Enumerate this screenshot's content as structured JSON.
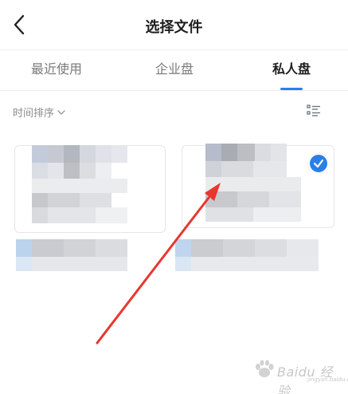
{
  "header": {
    "title": "选择文件",
    "back_icon": "chevron-left-icon"
  },
  "tabs": [
    {
      "label": "最近使用",
      "active": false
    },
    {
      "label": "企业盘",
      "active": false
    },
    {
      "label": "私人盘",
      "active": true
    }
  ],
  "sortbar": {
    "sort_label": "时间排序",
    "sort_icon": "chevron-down-icon",
    "view_icon": "list-view-icon"
  },
  "files": [
    {
      "selected": false,
      "blurred": true
    },
    {
      "selected": true,
      "blurred": true
    }
  ],
  "watermark": {
    "logo_text": "Baidu 经验",
    "url_text": "jingyan.baidu.com"
  },
  "colors": {
    "accent": "#2a7fe9",
    "annotation_arrow": "#e8372f"
  }
}
